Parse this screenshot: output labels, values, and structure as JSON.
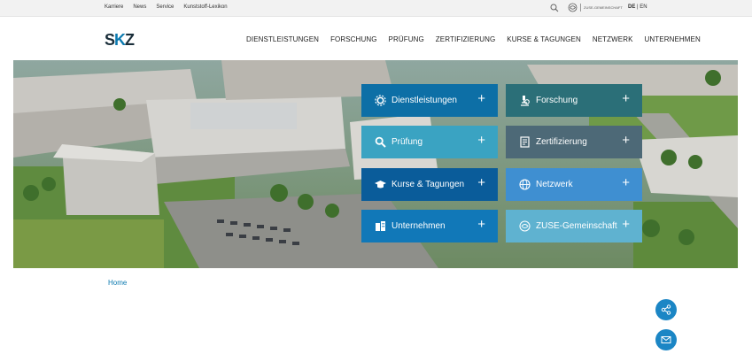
{
  "topbar": {
    "links": [
      "Karriere",
      "News",
      "Service",
      "Kunststoff-Lexikon"
    ],
    "zuse_label": "ZUSE-GEMEINSCHAFT",
    "lang_active": "DE",
    "lang_sep": "|",
    "lang_other": "EN"
  },
  "header": {
    "logo_s": "S",
    "logo_k": "K",
    "logo_z": "Z",
    "nav": [
      "DIENSTLEISTUNGEN",
      "FORSCHUNG",
      "PRÜFUNG",
      "ZERTIFIZIERUNG",
      "KURSE & TAGUNGEN",
      "NETZWERK",
      "UNTERNEHMEN"
    ]
  },
  "tiles": [
    {
      "label": "Dienstleistungen",
      "icon": "gears-icon",
      "color": "#0d6fa6"
    },
    {
      "label": "Forschung",
      "icon": "microscope-icon",
      "color": "#2b6f78"
    },
    {
      "label": "Prüfung",
      "icon": "magnifier-icon",
      "color": "#3aa3c2"
    },
    {
      "label": "Zertifizierung",
      "icon": "certificate-icon",
      "color": "#4d6977"
    },
    {
      "label": "Kurse & Tagungen",
      "icon": "graduation-cap-icon",
      "color": "#0a5c9a"
    },
    {
      "label": "Netzwerk",
      "icon": "globe-icon",
      "color": "#3f8fd1"
    },
    {
      "label": "Unternehmen",
      "icon": "building-icon",
      "color": "#1178b8"
    },
    {
      "label": "ZUSE-Gemeinschaft",
      "icon": "zuse-icon",
      "color": "#5fb2d0"
    }
  ],
  "tile_plus": "+",
  "breadcrumb": {
    "home": "Home"
  },
  "colors": {
    "accent": "#0c7ab0",
    "fab": "#1b86c5"
  }
}
